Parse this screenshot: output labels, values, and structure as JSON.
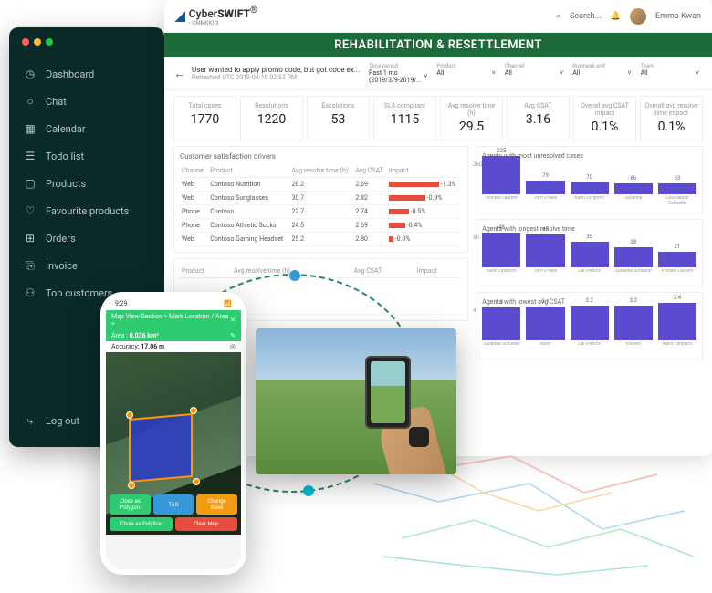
{
  "sidebar": {
    "items": [
      {
        "icon": "◷",
        "label": "Dashboard"
      },
      {
        "icon": "○",
        "label": "Chat"
      },
      {
        "icon": "▦",
        "label": "Calendar"
      },
      {
        "icon": "☰",
        "label": "Todo list"
      },
      {
        "icon": "▢",
        "label": "Products"
      },
      {
        "icon": "♡",
        "label": "Favourite products"
      },
      {
        "icon": "⊞",
        "label": "Orders"
      },
      {
        "icon": "⎘",
        "label": "Invoice"
      },
      {
        "icon": "⚇",
        "label": "Top customers"
      }
    ],
    "logout": {
      "icon": "⤷",
      "label": "Log out"
    }
  },
  "header": {
    "logo_prefix": "Cyber",
    "logo_bold": "SWIFT",
    "logo_sub": "• CMMI(K) 3",
    "search_icon": "⌕",
    "search_placeholder": "Search...",
    "bell": "🔔",
    "user": "Emma Kwan"
  },
  "banner": "REHABILITATION & RESETTLEMENT",
  "subhead": {
    "title": "User wanted to apply promo code, but got code ex...",
    "meta": "Refreshed UTC 2019-04-10 02:53 PM",
    "filters": [
      {
        "label": "Time period",
        "value": "Past 1 mo (2019/3/9-2019/..."
      },
      {
        "label": "Product",
        "value": "All"
      },
      {
        "label": "Channel",
        "value": "All"
      },
      {
        "label": "Business unit",
        "value": "All"
      },
      {
        "label": "Team",
        "value": "All"
      }
    ]
  },
  "kpis": [
    {
      "label": "Total cases",
      "value": "1770"
    },
    {
      "label": "Resolutions",
      "value": "1220"
    },
    {
      "label": "Escalations",
      "value": "53"
    },
    {
      "label": "SLA compliant",
      "value": "1115"
    },
    {
      "label": "Avg resolve time (h)",
      "value": "29.5"
    },
    {
      "label": "Avg CSAT",
      "value": "3.16"
    },
    {
      "label": "Overall avg CSAT impact",
      "value": "0.1%"
    },
    {
      "label": "Overall avg resolve time impact",
      "value": "0.1%"
    }
  ],
  "drivers": {
    "title": "Customer satisfaction drivers",
    "cols": [
      "Channel",
      "Product",
      "Avg resolve time (h)",
      "Avg CSAT",
      "Impact"
    ],
    "rows": [
      {
        "channel": "Web",
        "product": "Contoso Nutrition",
        "time": "26.2",
        "csat": "2.69",
        "bar": 55,
        "impact": "-1.3%"
      },
      {
        "channel": "Web",
        "product": "Contoso Sunglasses",
        "time": "30.7",
        "csat": "2.82",
        "bar": 40,
        "impact": "-0.9%"
      },
      {
        "channel": "Phone",
        "product": "Contoso",
        "time": "22.7",
        "csat": "2.74",
        "bar": 22,
        "impact": "-0.5%"
      },
      {
        "channel": "Phone",
        "product": "Contoso Athletic Socks",
        "time": "24.5",
        "csat": "2.69",
        "bar": 18,
        "impact": "-0.4%"
      },
      {
        "channel": "Web",
        "product": "Contoso Gaming Headset",
        "time": "25.2",
        "csat": "2.80",
        "bar": 5,
        "impact": "-0.0%"
      }
    ]
  },
  "drivers2": {
    "cols": [
      "Product",
      "Avg resolve time (h)",
      "Avg CSAT",
      "Impact"
    ]
  },
  "chart_data": [
    {
      "type": "bar",
      "title": "Agents with most unresolved cases",
      "ylim": [
        0,
        260
      ],
      "categories": [
        "Vincent Laurent",
        "Tom O'Neill",
        "Karin Zimprich",
        "Suzanne",
        "Cal Francis Schustin"
      ],
      "values": [
        225,
        79,
        70,
        66,
        63
      ]
    },
    {
      "type": "bar",
      "title": "Agents with longest resolve time",
      "ylim": [
        0,
        60
      ],
      "categories": [
        "Karin Zimprich",
        "Tom O'Neill",
        "Cal Francis",
        "Suzanne Schustin",
        "Vincent Laurent"
      ],
      "values": [
        48,
        45,
        35,
        28,
        21
      ]
    },
    {
      "type": "bar",
      "title": "Agents with lowest avg CSAT",
      "ylim": [
        0,
        4
      ],
      "categories": [
        "Suzanne Schustin",
        "Karin",
        "Cal Francis",
        "Vincent",
        "Karin Zimprich"
      ],
      "values": [
        3.0,
        3.1,
        3.2,
        3.2,
        3.4
      ]
    }
  ],
  "phone": {
    "time": "9:29",
    "breadcrumb": "Map View Section > Mark Location / Area >",
    "close": "✕",
    "area_label": "Area :",
    "area_value": "0.036 km²",
    "edit": "✎",
    "accuracy_label": "Accuracy:",
    "accuracy_value": "17.06 m",
    "target": "◎",
    "buttons": {
      "polygon": "Close as Polygon",
      "tag": "TAG",
      "change": "Change Base",
      "polyline": "Close as Polyline",
      "clear": "Clear Map"
    }
  }
}
